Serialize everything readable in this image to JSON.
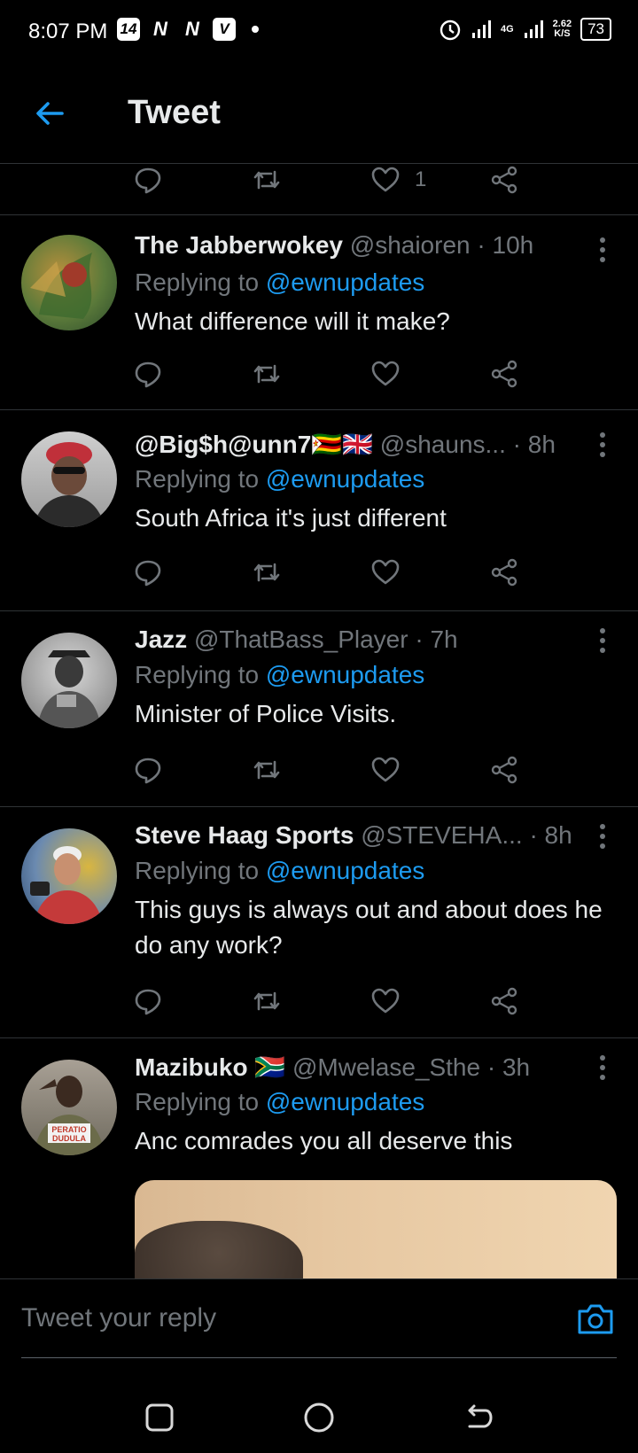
{
  "status_bar": {
    "time": "8:07 PM",
    "apps": [
      "14",
      "N",
      "N",
      "V"
    ],
    "network_top": "4G",
    "speed_value": "2.62",
    "speed_unit": "K/S",
    "battery": "73"
  },
  "header": {
    "title": "Tweet"
  },
  "previous_tweet": {
    "like_count": "1"
  },
  "tweets": [
    {
      "name": "The Jabberwokey",
      "handle": "@shaioren",
      "time": "· 10h",
      "replying_prefix": "Replying to",
      "replying_to": "@ewnupdates",
      "text": "What difference will it make?"
    },
    {
      "name": "@Big$h@unn7",
      "flags": "🇿🇼🇬🇧",
      "handle": "@shauns...",
      "time": "· 8h",
      "replying_prefix": "Replying to",
      "replying_to": "@ewnupdates",
      "text": "South Africa it's just different"
    },
    {
      "name": "Jazz",
      "handle": "@ThatBass_Player",
      "time": "· 7h",
      "replying_prefix": "Replying to",
      "replying_to": "@ewnupdates",
      "text": "Minister of Police Visits."
    },
    {
      "name": "Steve Haag Sports",
      "handle": "@STEVEHA...",
      "time": "· 8h",
      "replying_prefix": "Replying to",
      "replying_to": "@ewnupdates",
      "text": "This guys is always out and about does he do any work?"
    },
    {
      "name": "Mazibuko",
      "flags": "🇿🇦",
      "handle": "@Mwelase_Sthe",
      "time": "· 3h",
      "replying_prefix": "Replying to",
      "replying_to": "@ewnupdates",
      "text": "Anc comrades you all deserve this",
      "avatar_text": "PERATIO DUDULA"
    }
  ],
  "composer": {
    "placeholder": "Tweet your reply"
  },
  "colors": {
    "accent": "#1d9bf0",
    "muted": "#71767b",
    "background": "#000000",
    "divider": "#2f3336"
  },
  "icons": {
    "back": "arrow-left-icon",
    "more": "more-vertical-icon",
    "reply": "reply-icon",
    "retweet": "retweet-icon",
    "like": "heart-icon",
    "share": "share-icon",
    "camera": "camera-icon"
  }
}
